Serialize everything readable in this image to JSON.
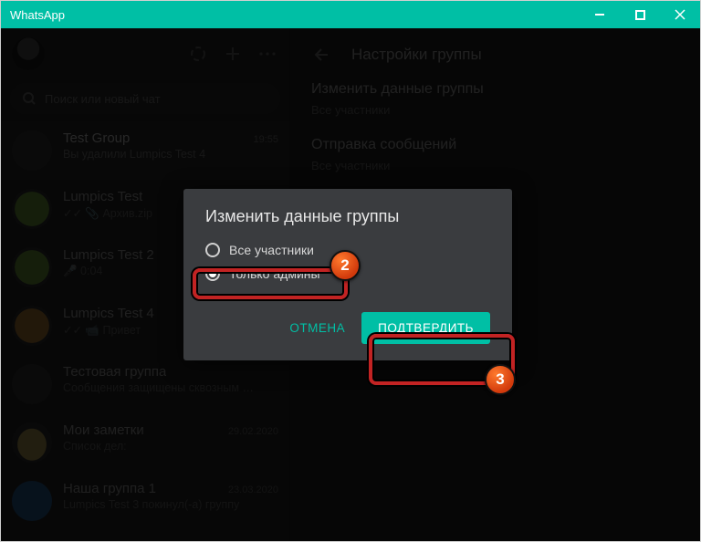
{
  "window": {
    "title": "WhatsApp"
  },
  "sidebar": {
    "search_placeholder": "Поиск или новый чат",
    "chats": [
      {
        "name": "Test Group",
        "time": "19:55",
        "preview": "Вы удалили Lumpics Test 4"
      },
      {
        "name": "Lumpics Test",
        "time": "",
        "preview": "✓✓ 📎 Архив.zip"
      },
      {
        "name": "Lumpics Test 2",
        "time": "",
        "preview": "🎤 0:04"
      },
      {
        "name": "Lumpics Test 4",
        "time": "",
        "preview": "✓✓ 📹 Привет"
      },
      {
        "name": "Тестовая группа",
        "time": "",
        "preview": "Сообщения защищены сквозным …"
      },
      {
        "name": "Мои заметки",
        "time": "29.02.2020",
        "preview": "Список дел:"
      },
      {
        "name": "Наша группа 1",
        "time": "23.03.2020",
        "preview": "Lumpics Test 3 покинул(-а) группу"
      }
    ]
  },
  "content": {
    "back_label": "←",
    "title": "Настройки группы",
    "sections": [
      {
        "title": "Изменить данные группы",
        "subtitle": "Все участники"
      },
      {
        "title": "Отправка сообщений",
        "subtitle": "Все участники"
      }
    ]
  },
  "dialog": {
    "title": "Изменить данные группы",
    "options": [
      {
        "label": "Все участники",
        "selected": false
      },
      {
        "label": "Только админы",
        "selected": true
      }
    ],
    "cancel": "ОТМЕНА",
    "confirm": "ПОДТВЕРДИТЬ"
  },
  "annotations": {
    "badge2": "2",
    "badge3": "3"
  }
}
